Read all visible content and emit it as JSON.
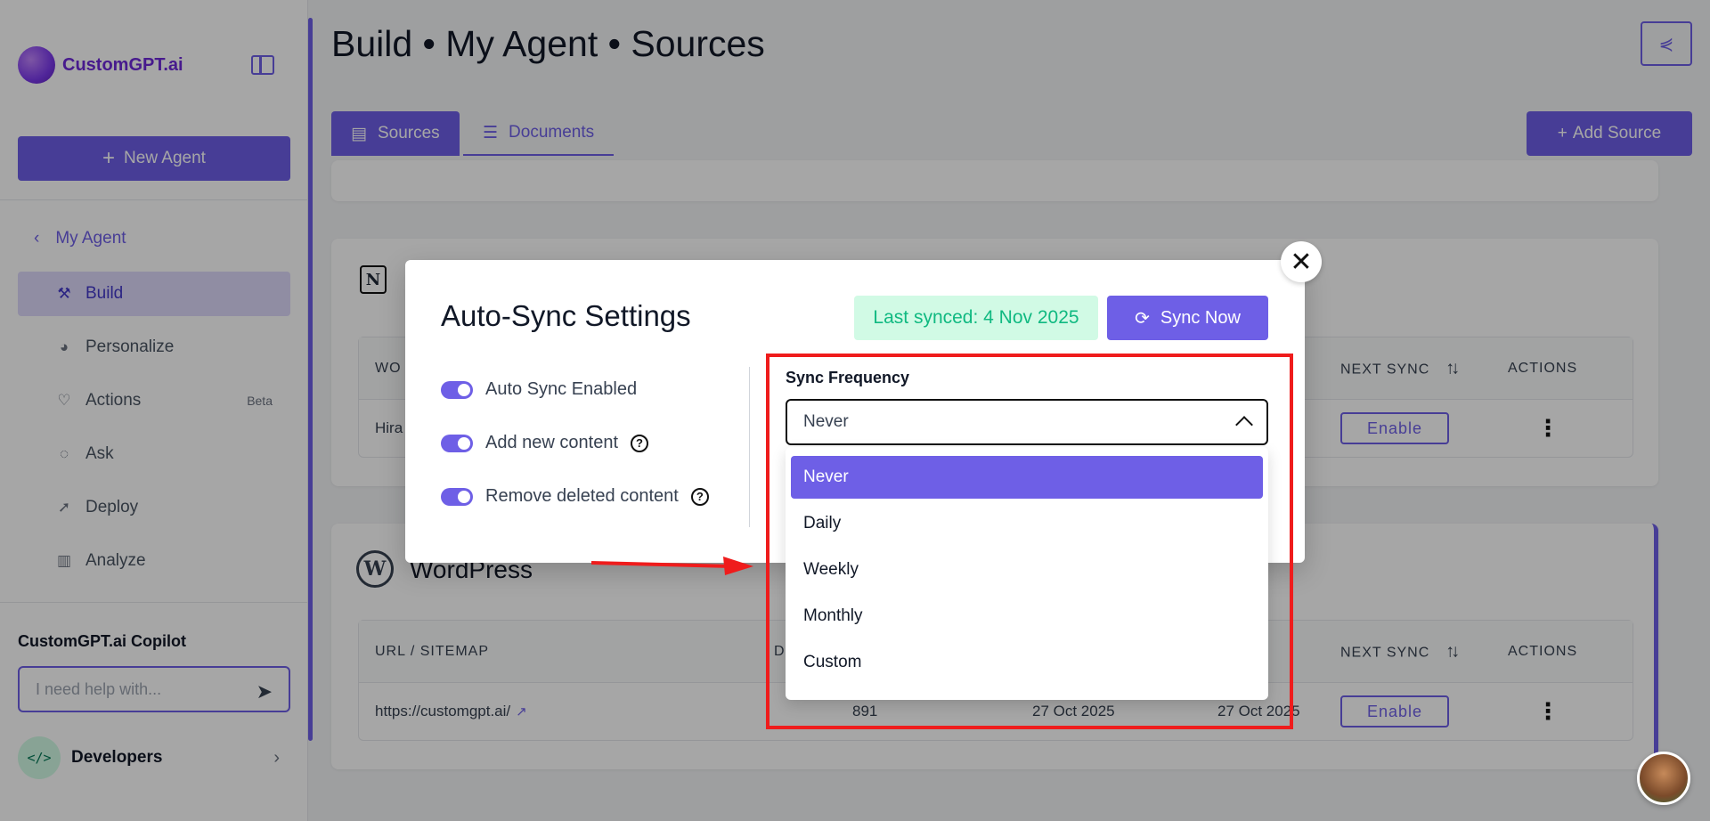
{
  "sidebar": {
    "brand": "CustomGPT.ai",
    "new_agent": "New Agent",
    "agent_name": "My Agent",
    "items": [
      {
        "label": "Build",
        "icon": "build-icon"
      },
      {
        "label": "Personalize",
        "icon": "palette-icon"
      },
      {
        "label": "Actions",
        "icon": "heart-hand-icon",
        "badge": "Beta"
      },
      {
        "label": "Ask",
        "icon": "chat-icon"
      },
      {
        "label": "Deploy",
        "icon": "rocket-icon"
      },
      {
        "label": "Analyze",
        "icon": "bar-chart-icon"
      }
    ],
    "copilot_title": "CustomGPT.ai Copilot",
    "copilot_placeholder": "I need help with...",
    "developers": "Developers"
  },
  "header": {
    "title": "Build • My Agent • Sources"
  },
  "tabs": [
    {
      "label": "Sources"
    },
    {
      "label": "Documents"
    }
  ],
  "add_source": "Add Source",
  "notion_table": {
    "col_first": "WO",
    "col_next_sync": "NEXT SYNC",
    "col_actions": "ACTIONS",
    "row_first": "Hira",
    "enable": "Enable"
  },
  "wordpress": {
    "title": "WordPress",
    "columns": {
      "url": "URL / SITEMAP",
      "d": "D",
      "next_sync": "NEXT SYNC",
      "actions": "ACTIONS"
    },
    "row": {
      "url": "https://customgpt.ai/",
      "count": "891",
      "date1": "27 Oct 2025",
      "date2": "27 Oct 2025",
      "enable": "Enable"
    }
  },
  "modal": {
    "title": "Auto-Sync Settings",
    "last_synced": "Last synced: 4 Nov 2025",
    "sync_now": "Sync Now",
    "toggles": [
      {
        "label": "Auto Sync Enabled",
        "on": true
      },
      {
        "label": "Add new content",
        "on": true
      },
      {
        "label": "Remove deleted content",
        "on": true
      }
    ],
    "frequency_label": "Sync Frequency",
    "frequency_value": "Never",
    "options": [
      "Never",
      "Daily",
      "Weekly",
      "Monthly",
      "Custom"
    ]
  },
  "colors": {
    "accent": "#6e5fe6",
    "highlight": "#ef1c1c",
    "success_bg": "#d1fae5",
    "success_text": "#10b981"
  }
}
